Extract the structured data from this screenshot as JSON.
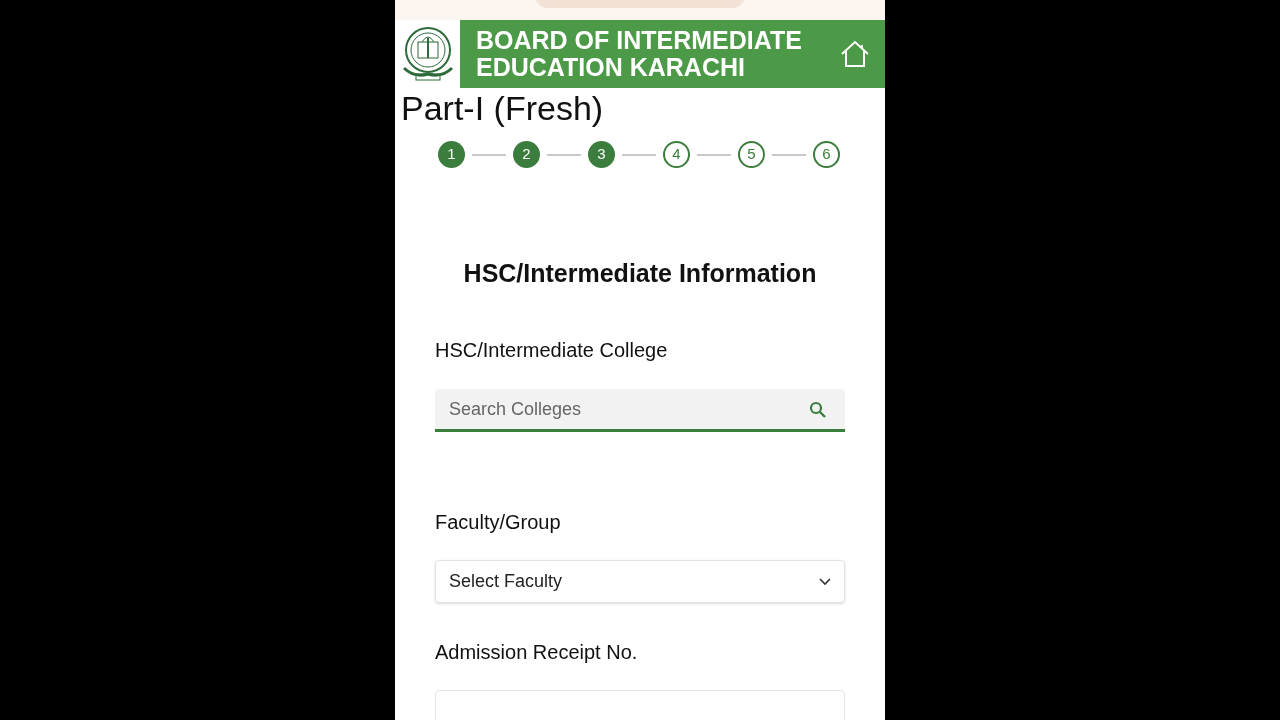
{
  "header": {
    "title_line_1": "BOARD OF INTERMEDIATE",
    "title_line_2": "EDUCATION KARACHI"
  },
  "page_title": "Part-I (Fresh)",
  "steps": [
    {
      "label": "1",
      "done": true
    },
    {
      "label": "2",
      "done": true
    },
    {
      "label": "3",
      "done": true
    },
    {
      "label": "4",
      "done": false
    },
    {
      "label": "5",
      "done": false
    },
    {
      "label": "6",
      "done": false
    }
  ],
  "section_title": "HSC/Intermediate Information",
  "fields": [
    {
      "kind": "search",
      "label": "HSC/Intermediate College",
      "placeholder": "Search Colleges"
    },
    {
      "kind": "select",
      "label": "Faculty/Group",
      "value": "Select Faculty"
    },
    {
      "kind": "text",
      "label": "Admission Receipt No."
    }
  ]
}
